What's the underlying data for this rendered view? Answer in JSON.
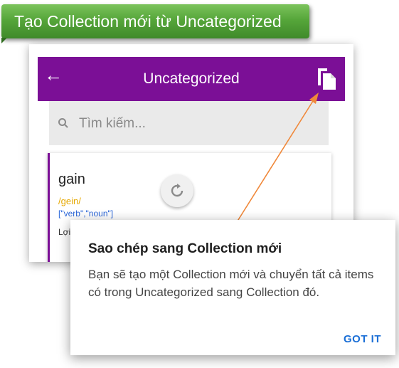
{
  "banner": {
    "text": "Tạo Collection mới từ Uncategorized"
  },
  "app": {
    "title": "Uncategorized",
    "back_icon": "arrow-left-icon",
    "copy_icon": "copy-icon",
    "accent_color": "#7b0f96"
  },
  "search": {
    "placeholder": "Tìm kiếm...",
    "icon": "search-icon"
  },
  "word_card": {
    "word": "gain",
    "phonetic": "/gein/",
    "types": "[\"verb\",\"noun\"]",
    "meaning_label": "Lợi"
  },
  "refresh_icon": "refresh-icon",
  "dialog": {
    "title": "Sao chép sang Collection mới",
    "body": "Bạn sẽ tạo một Collection mới và chuyển tất cả items có trong Uncategorized sang Collection đó.",
    "action": "GOT IT"
  }
}
